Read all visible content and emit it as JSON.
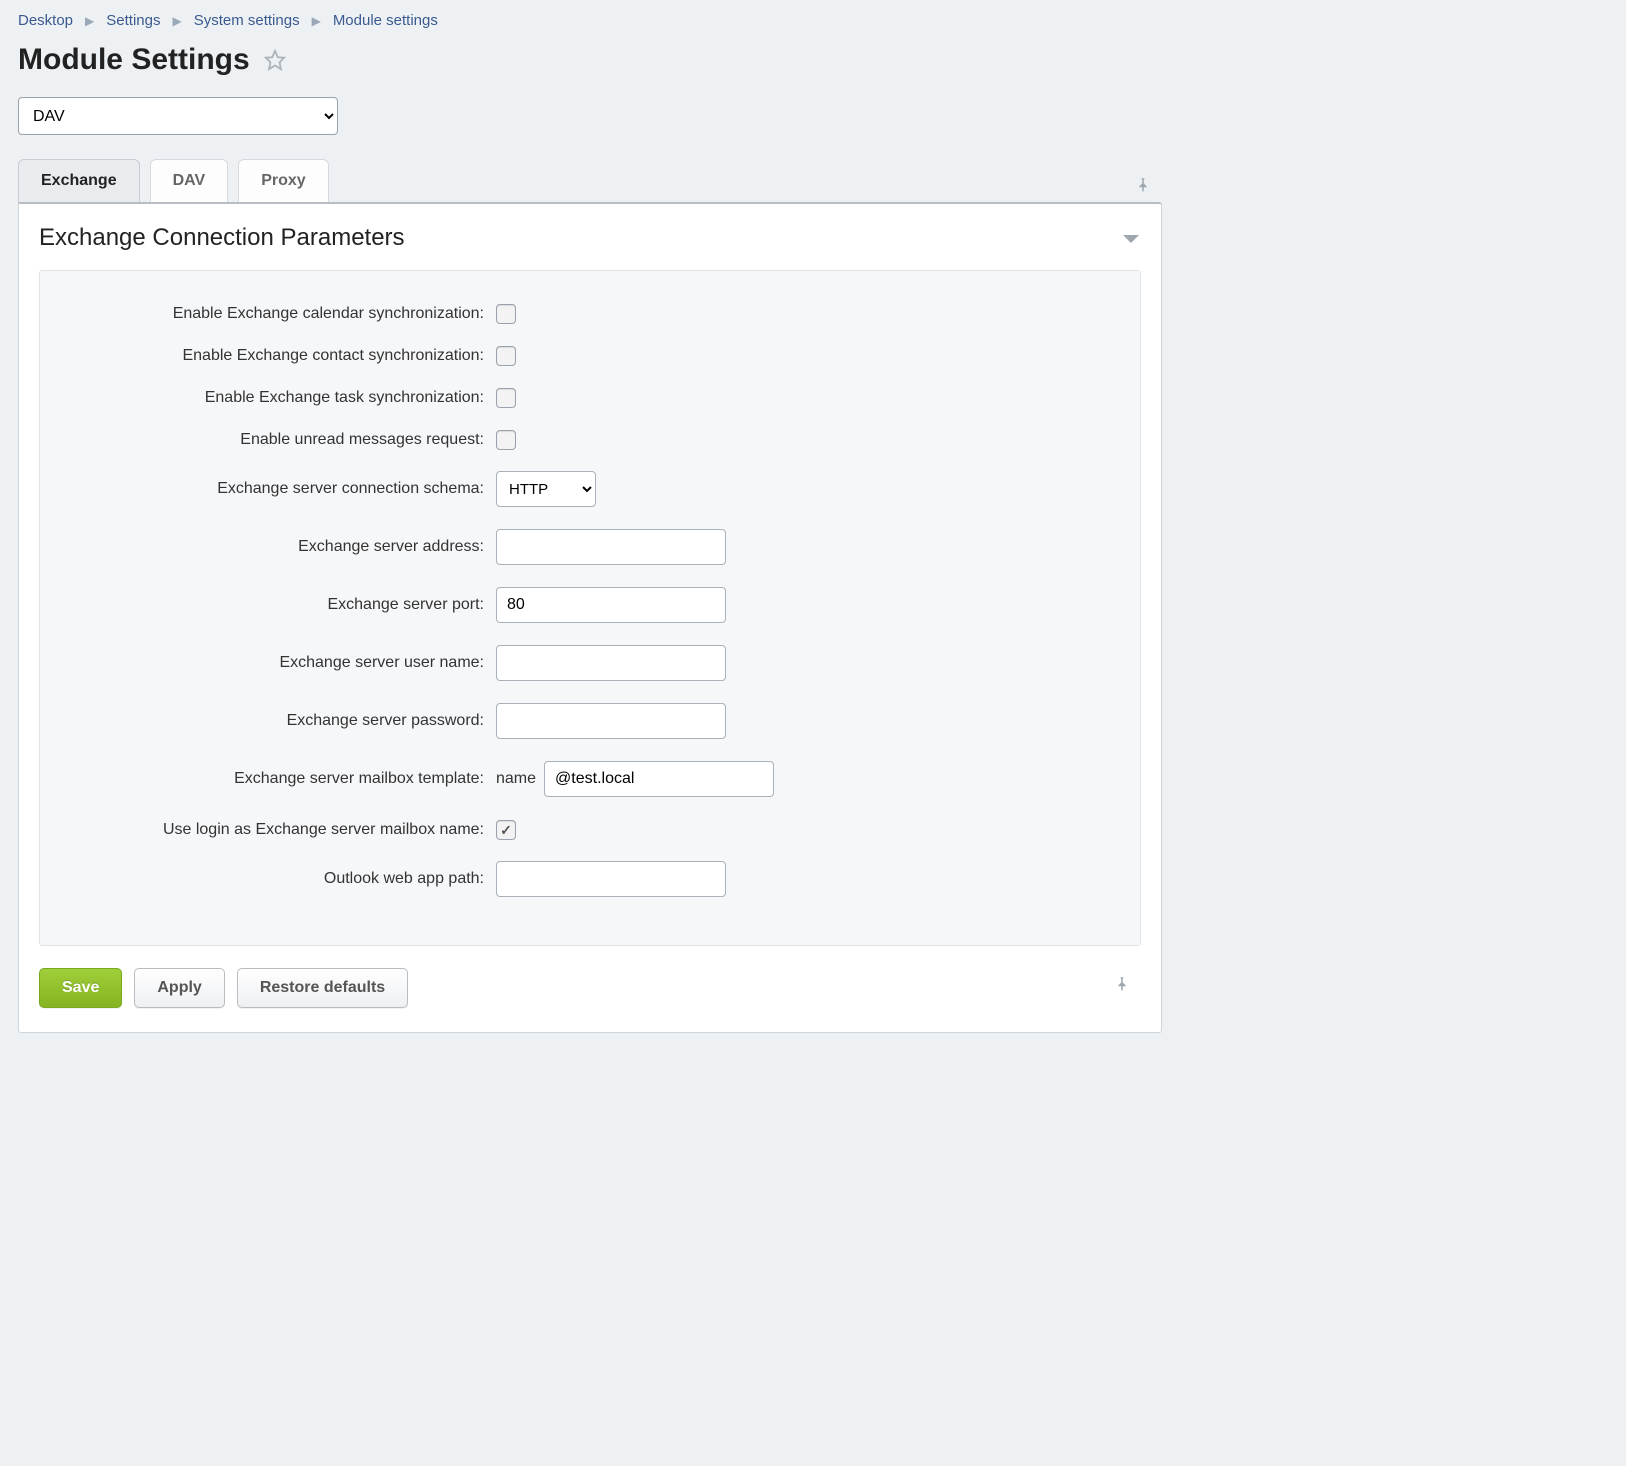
{
  "breadcrumb": {
    "items": [
      "Desktop",
      "Settings",
      "System settings",
      "Module settings"
    ]
  },
  "page_title": "Module Settings",
  "module_selector": {
    "value": "DAV"
  },
  "tabs": {
    "items": [
      {
        "label": "Exchange",
        "active": true
      },
      {
        "label": "DAV",
        "active": false
      },
      {
        "label": "Proxy",
        "active": false
      }
    ]
  },
  "panel": {
    "title": "Exchange Connection Parameters",
    "fields": {
      "calendar_sync": {
        "label": "Enable Exchange calendar synchronization:",
        "checked": false
      },
      "contact_sync": {
        "label": "Enable Exchange contact synchronization:",
        "checked": false
      },
      "task_sync": {
        "label": "Enable Exchange task synchronization:",
        "checked": false
      },
      "unread_req": {
        "label": "Enable unread messages request:",
        "checked": false
      },
      "schema": {
        "label": "Exchange server connection schema:",
        "value": "HTTP"
      },
      "address": {
        "label": "Exchange server address:",
        "value": ""
      },
      "port": {
        "label": "Exchange server port:",
        "value": "80"
      },
      "username": {
        "label": "Exchange server user name:",
        "value": ""
      },
      "password": {
        "label": "Exchange server password:",
        "value": ""
      },
      "mailbox_tpl": {
        "label": "Exchange server mailbox template:",
        "prefix": "name",
        "value": "@test.local"
      },
      "use_login": {
        "label": "Use login as Exchange server mailbox name:",
        "checked": true
      },
      "owa_path": {
        "label": "Outlook web app path:",
        "value": ""
      }
    }
  },
  "footer": {
    "save": "Save",
    "apply": "Apply",
    "restore": "Restore defaults"
  }
}
